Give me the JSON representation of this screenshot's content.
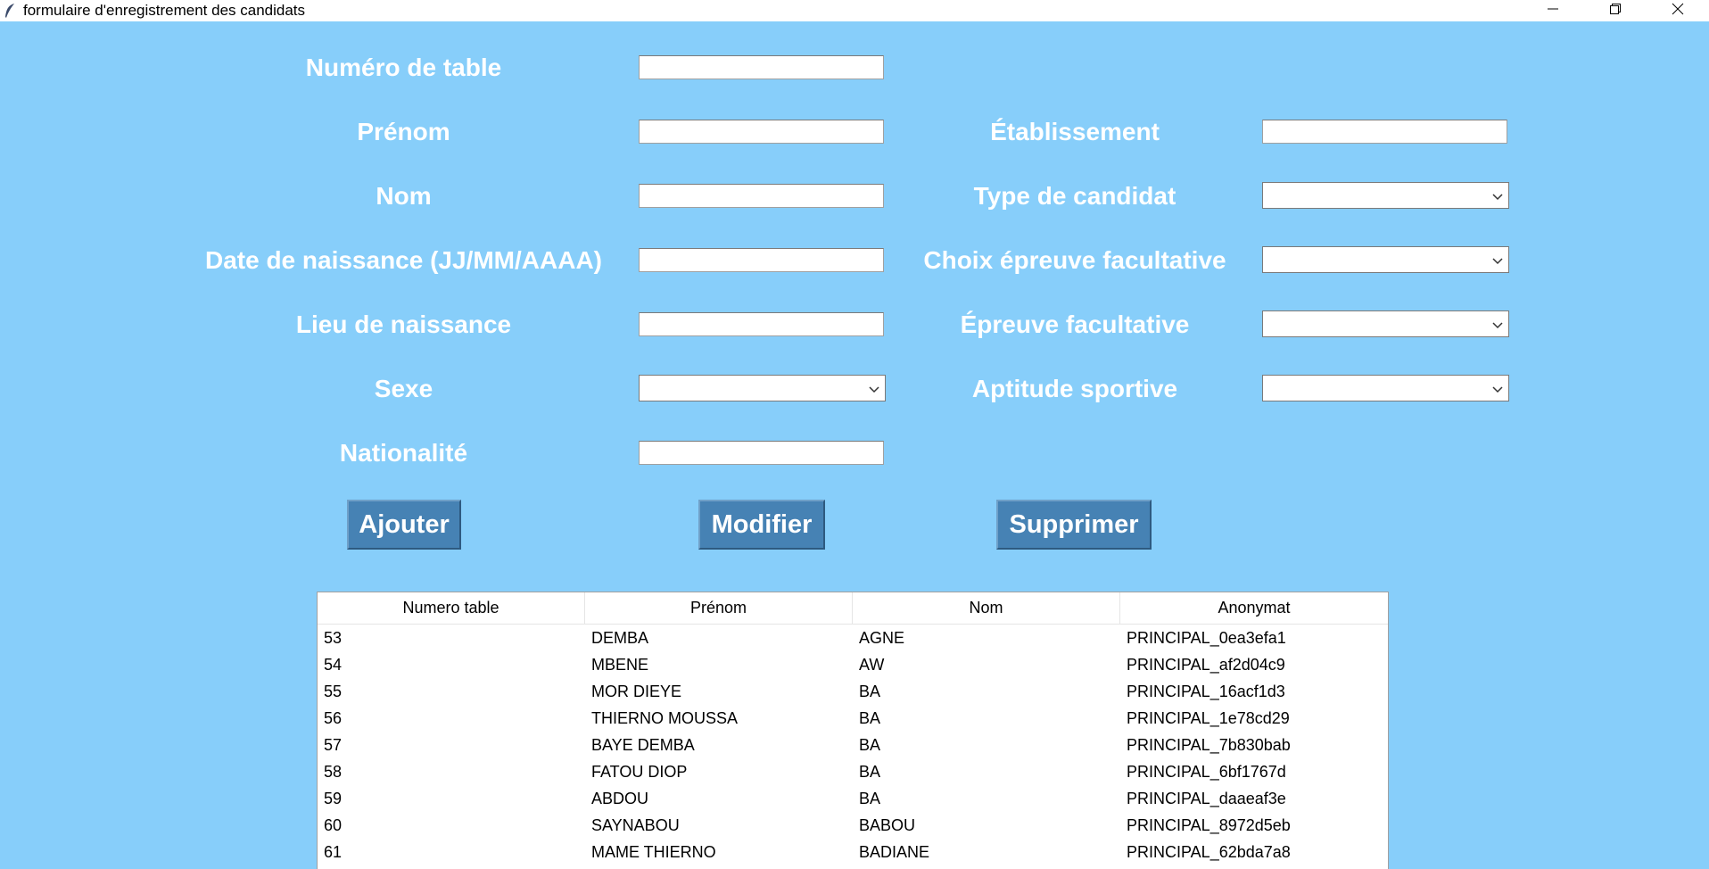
{
  "window": {
    "title": "formulaire d'enregistrement des candidats",
    "icon": "feather-icon",
    "controls": [
      "minimize-icon",
      "restore-icon",
      "close-icon"
    ]
  },
  "form": {
    "left": {
      "numero_table": "Numéro de table",
      "prenom": "Prénom",
      "nom": "Nom",
      "date_naissance": "Date de naissance (JJ/MM/AAAA)",
      "lieu_naissance": "Lieu de naissance",
      "sexe": "Sexe",
      "nationalite": "Nationalité"
    },
    "right": {
      "etablissement": "Établissement",
      "type_candidat": "Type de candidat",
      "choix_epreuve": "Choix épreuve facultative",
      "epreuve_facultative": "Épreuve facultative",
      "aptitude_sportive": "Aptitude sportive"
    },
    "values": {
      "numero_table": "",
      "prenom": "",
      "nom": "",
      "date_naissance": "",
      "lieu_naissance": "",
      "sexe": "",
      "nationalite": "",
      "etablissement": "",
      "type_candidat": "",
      "choix_epreuve": "",
      "epreuve_facultative": "",
      "aptitude_sportive": ""
    }
  },
  "buttons": {
    "ajouter": "Ajouter",
    "modifier": "Modifier",
    "supprimer": "Supprimer"
  },
  "table": {
    "headers": [
      "Numero table",
      "Prénom",
      "Nom",
      "Anonymat"
    ],
    "rows": [
      [
        "53",
        "DEMBA",
        "AGNE",
        "PRINCIPAL_0ea3efa1"
      ],
      [
        "54",
        "MBENE",
        "AW",
        "PRINCIPAL_af2d04c9"
      ],
      [
        "55",
        "MOR DIEYE",
        "BA",
        "PRINCIPAL_16acf1d3"
      ],
      [
        "56",
        "THIERNO MOUSSA",
        "BA",
        "PRINCIPAL_1e78cd29"
      ],
      [
        "57",
        "BAYE DEMBA",
        "BA",
        "PRINCIPAL_7b830bab"
      ],
      [
        "58",
        "FATOU DIOP",
        "BA",
        "PRINCIPAL_6bf1767d"
      ],
      [
        "59",
        "ABDOU",
        "BA",
        "PRINCIPAL_daaeaf3e"
      ],
      [
        "60",
        "SAYNABOU",
        "BABOU",
        "PRINCIPAL_8972d5eb"
      ],
      [
        "61",
        "MAME THIERNO",
        "BADIANE",
        "PRINCIPAL_62bda7a8"
      ]
    ]
  },
  "colors": {
    "background": "#87cefa",
    "button": "#4682b4",
    "label": "#ffffff"
  }
}
